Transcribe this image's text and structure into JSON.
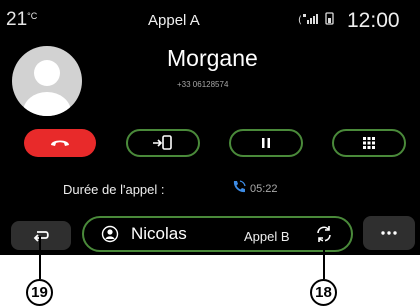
{
  "status_bar": {
    "temperature": "21",
    "temperature_unit": "°C",
    "title": "Appel A",
    "clock": "12:00"
  },
  "caller": {
    "name": "Morgane",
    "number": "+33 06128574"
  },
  "controls": {
    "hangup_icon": "phone-hangup-icon",
    "transfer_icon": "phone-transfer-icon",
    "pause_icon": "pause-icon",
    "keypad_icon": "keypad-icon"
  },
  "duration": {
    "label": "Durée de l'appel :",
    "time": "05:22"
  },
  "second_call": {
    "name": "Nicolas",
    "label": "Appel B"
  },
  "callouts": {
    "back": "19",
    "swap": "18"
  },
  "colors": {
    "accent_green": "#4a8a3a",
    "hangup_red": "#e82a2a",
    "phone_icon_blue": "#3d8ce6"
  }
}
